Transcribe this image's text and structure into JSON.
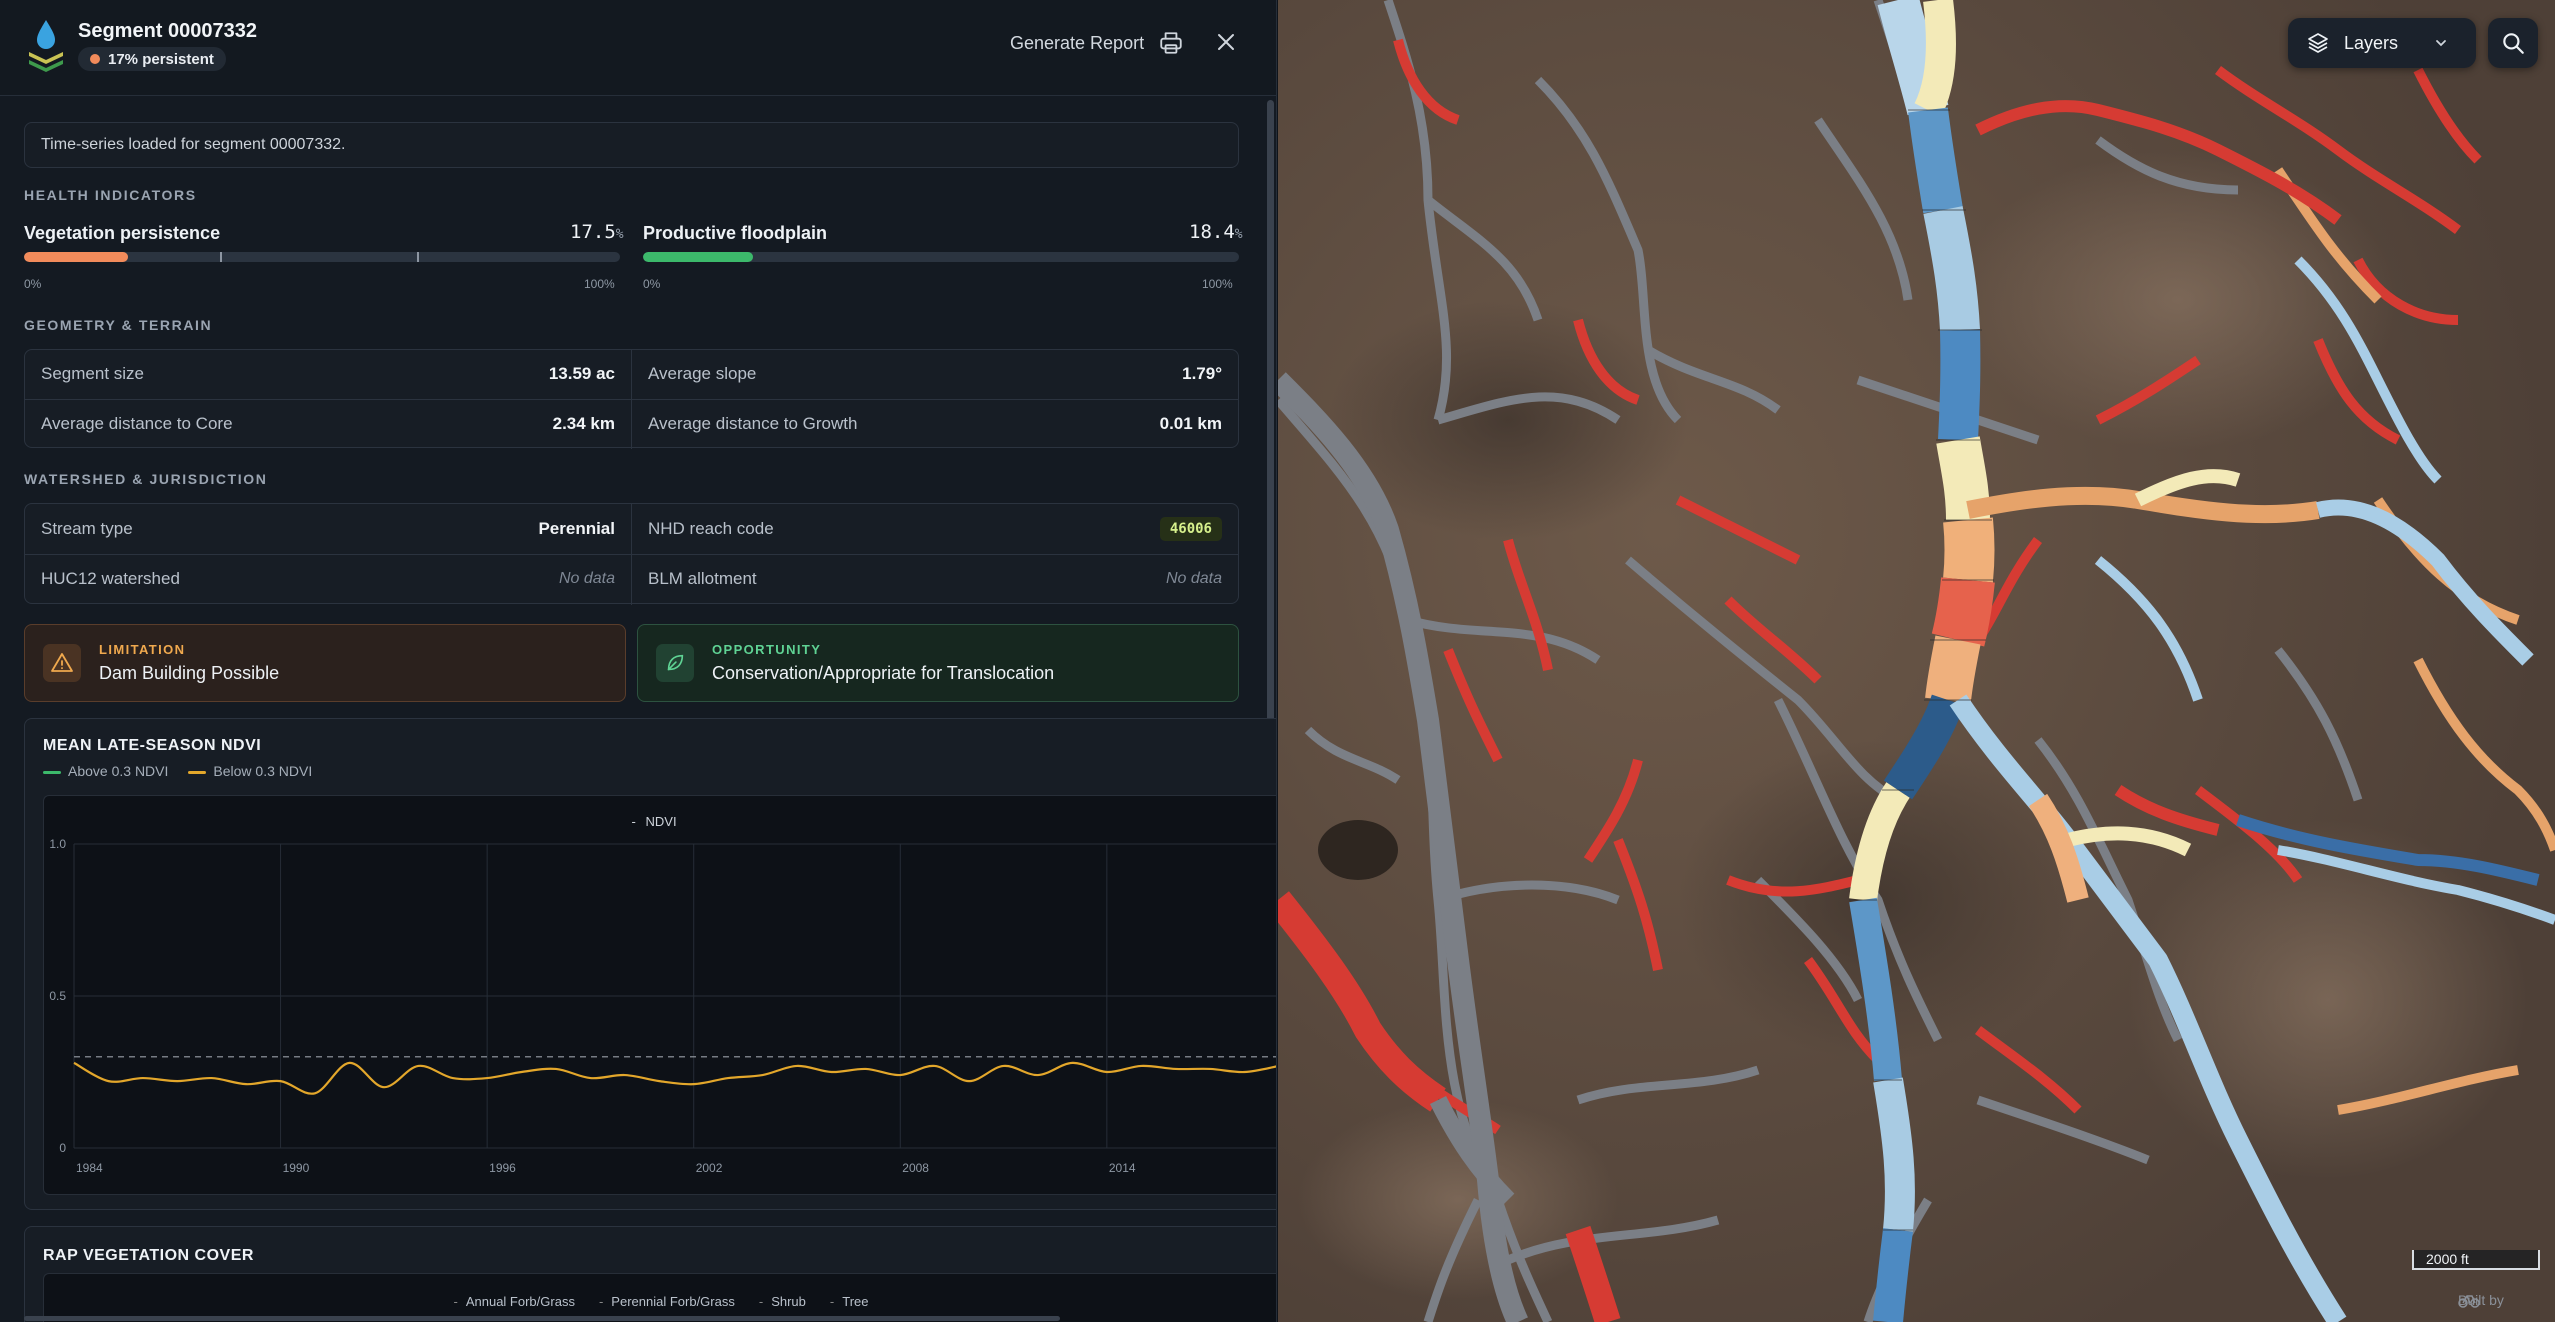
{
  "header": {
    "segment_title": "Segment 00007332",
    "persistence_badge": "17% persistent",
    "generate_report_label": "Generate Report"
  },
  "info_message": "Time-series loaded for segment 00007332.",
  "health": {
    "section_title": "HEALTH INDICATORS",
    "vegetation": {
      "label": "Vegetation persistence",
      "value": "17.5",
      "unit": "%",
      "fraction": 0.175,
      "min": "0%",
      "max": "100%"
    },
    "floodplain": {
      "label": "Productive floodplain",
      "value": "18.4",
      "unit": "%",
      "fraction": 0.184,
      "min": "0%",
      "max": "100%"
    }
  },
  "geometry": {
    "section_title": "GEOMETRY & TERRAIN",
    "segment_size_label": "Segment size",
    "segment_size_value": "13.59 ac",
    "avg_slope_label": "Average slope",
    "avg_slope_value": "1.79°",
    "dist_core_label": "Average distance to Core",
    "dist_core_value": "2.34 km",
    "dist_growth_label": "Average distance to Growth",
    "dist_growth_value": "0.01 km"
  },
  "watershed": {
    "section_title": "WATERSHED & JURISDICTION",
    "stream_type_label": "Stream type",
    "stream_type_value": "Perennial",
    "nhd_label": "NHD reach code",
    "nhd_value": "46006",
    "huc12_label": "HUC12 watershed",
    "huc12_value": "No data",
    "blm_label": "BLM allotment",
    "blm_value": "No data"
  },
  "limitation": {
    "kicker": "LIMITATION",
    "text": "Dam Building Possible"
  },
  "opportunity": {
    "kicker": "OPPORTUNITY",
    "text": "Conservation/Appropriate for Translocation"
  },
  "ndvi": {
    "title": "MEAN LATE-SEASON NDVI",
    "legend_above": "Above 0.3 NDVI",
    "legend_below": "Below 0.3 NDVI",
    "series_label": "NDVI"
  },
  "chart_data": {
    "type": "line",
    "title": "",
    "xlabel": "",
    "ylabel": "",
    "x": [
      1984,
      1985,
      1986,
      1987,
      1988,
      1989,
      1990,
      1991,
      1992,
      1993,
      1994,
      1995,
      1996,
      1997,
      1998,
      1999,
      2000,
      2001,
      2002,
      2003,
      2004,
      2005,
      2006,
      2007,
      2008,
      2009,
      2010,
      2011,
      2012,
      2013,
      2014,
      2015,
      2016,
      2017,
      2018,
      2019
    ],
    "xticks": [
      1984,
      1990,
      1996,
      2002,
      2008,
      2014
    ],
    "yticks": [
      0,
      0.5,
      1.0
    ],
    "ytick_labels": [
      "0",
      "0.5",
      "1.0"
    ],
    "ylim": [
      0,
      1.0
    ],
    "threshold": 0.3,
    "series": [
      {
        "name": "NDVI",
        "values": [
          0.28,
          0.22,
          0.23,
          0.22,
          0.23,
          0.21,
          0.22,
          0.18,
          0.28,
          0.2,
          0.27,
          0.23,
          0.23,
          0.25,
          0.26,
          0.23,
          0.24,
          0.22,
          0.21,
          0.23,
          0.24,
          0.27,
          0.25,
          0.26,
          0.24,
          0.27,
          0.22,
          0.27,
          0.24,
          0.28,
          0.25,
          0.27,
          0.26,
          0.26,
          0.25,
          0.27
        ]
      }
    ]
  },
  "rap": {
    "title": "RAP VEGETATION COVER",
    "legend": [
      "Annual Forb/Grass",
      "Perennial Forb/Grass",
      "Shrub",
      "Tree"
    ]
  },
  "map": {
    "layers_label": "Layers",
    "scale_label": "2000 ft",
    "built_by_label": "Built by"
  },
  "colors": {
    "accent_orange": "#f28b5b",
    "accent_green": "#3cb96b",
    "ndvi_line": "#e3a72b",
    "limitation": "#f0a94e",
    "opportunity": "#5fd394"
  }
}
